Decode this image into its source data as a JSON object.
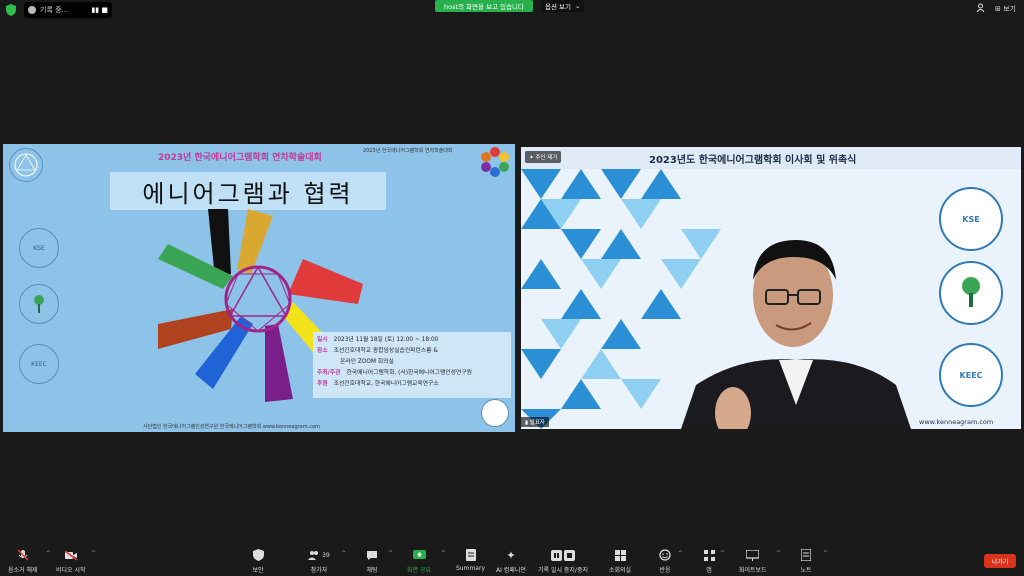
{
  "topbar": {
    "rec_label": "기록 중...",
    "rec_controls": "▮▮  ■",
    "share_banner": "host의 화면을 보고 있습니다",
    "view_options": "옵션 보기",
    "view_options_caret": "⌄",
    "view_label": "보기"
  },
  "left_slide": {
    "top_title": "2023년 한국에니어그램학회 연차학술대회",
    "sub_title": "2023년 한국에니어그램학회 연차학술대회",
    "main_title": "에니어그램과 협력",
    "info": [
      {
        "key": "일시",
        "value": "2023년 11월 18일 (토) 12:00 ~ 18:00"
      },
      {
        "key": "장소",
        "value": "조선간호대학교 종합임상실습컨퍼런스룸 &"
      },
      {
        "key": "",
        "value": "온라인 ZOOM 회의실"
      },
      {
        "key": "주최/주관",
        "value": "한국에니어그램학회, (사)한국에니어그램인성연구원"
      },
      {
        "key": "후원",
        "value": "조선간호대학교, 한국에니어그램교육연구소"
      }
    ],
    "footer": "사단법인 한국에니어그램인성연구원    한국에니어그램학회    www.kenneagram.com",
    "logos": [
      "KSE",
      "",
      "KEEC"
    ]
  },
  "right_tile": {
    "pin_label": "주인 제거",
    "title": "2023년도 한국에니어그램학회 이사회 및 위촉식",
    "url": "www.kenneagram.com",
    "speaker": "발표자",
    "logos": [
      "KSE",
      "",
      "KEEC"
    ]
  },
  "toolbar": {
    "items": [
      {
        "label": "음소거 해제",
        "icon": "mic-muted-icon"
      },
      {
        "label": "비디오 시작",
        "icon": "video-off-icon"
      },
      {
        "label": "보안",
        "icon": "shield-icon"
      },
      {
        "label": "참가자",
        "icon": "participants-icon",
        "count": "39"
      },
      {
        "label": "채팅",
        "icon": "chat-icon"
      },
      {
        "label": "화면 공유",
        "icon": "share-screen-icon"
      },
      {
        "label": "Summary",
        "icon": "summary-icon"
      },
      {
        "label": "AI 컴패니언",
        "icon": "ai-companion-icon"
      },
      {
        "label": "기록 일시 중지/중지",
        "icon": "record-pause-icon"
      },
      {
        "label": "소회의실",
        "icon": "breakout-icon"
      },
      {
        "label": "반응",
        "icon": "reactions-icon"
      },
      {
        "label": "앱",
        "icon": "apps-icon"
      },
      {
        "label": "화이트보드",
        "icon": "whiteboard-icon"
      },
      {
        "label": "노트",
        "icon": "notes-icon"
      }
    ],
    "leave_label": "나가기"
  },
  "colors": {
    "share_green": "#27b04b",
    "leave_red": "#d9331c",
    "slide_bg": "#8ec3e9"
  }
}
